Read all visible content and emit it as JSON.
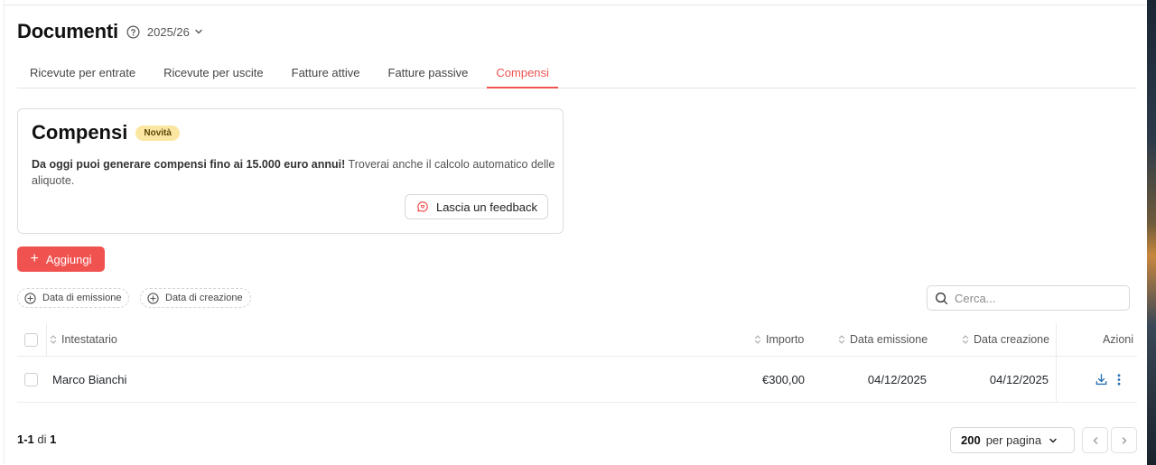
{
  "header": {
    "title": "Documenti",
    "year": "2025/26"
  },
  "tabs": [
    {
      "label": "Ricevute per entrate"
    },
    {
      "label": "Ricevute per uscite"
    },
    {
      "label": "Fatture attive"
    },
    {
      "label": "Fatture passive"
    },
    {
      "label": "Compensi",
      "active": true
    }
  ],
  "card": {
    "title": "Compensi",
    "badge": "Novità",
    "text_bold": "Da oggi puoi generare compensi fino ai 15.000 euro annui!",
    "text_rest": " Troverai anche il calcolo automatico delle aliquote.",
    "feedback_label": "Lascia un feedback"
  },
  "toolbar": {
    "add_label": "Aggiungi",
    "filters": [
      "Data di emissione",
      "Data di creazione"
    ],
    "search_placeholder": "Cerca..."
  },
  "table": {
    "columns": {
      "holder": "Intestatario",
      "amount": "Importo",
      "issue_date": "Data emissione",
      "creation_date": "Data creazione",
      "actions": "Azioni"
    },
    "rows": [
      {
        "holder": "Marco Bianchi",
        "amount": "€300,00",
        "issue_date": "04/12/2025",
        "creation_date": "04/12/2025"
      }
    ]
  },
  "footer": {
    "range": "1-1",
    "of_label": "di",
    "total": "1",
    "per_page_value": "200",
    "per_page_label": "per pagina"
  },
  "colors": {
    "accent": "#f0524f",
    "badge_bg": "#fbe7a1",
    "action_icon": "#2a6fb0"
  },
  "icons": [
    "help-circle-icon",
    "chevron-down-icon",
    "feedback-icon",
    "plus-icon",
    "add-circle-icon",
    "search-icon",
    "sort-icon",
    "download-icon",
    "more-vertical-icon",
    "chevron-left-icon",
    "chevron-right-icon"
  ]
}
